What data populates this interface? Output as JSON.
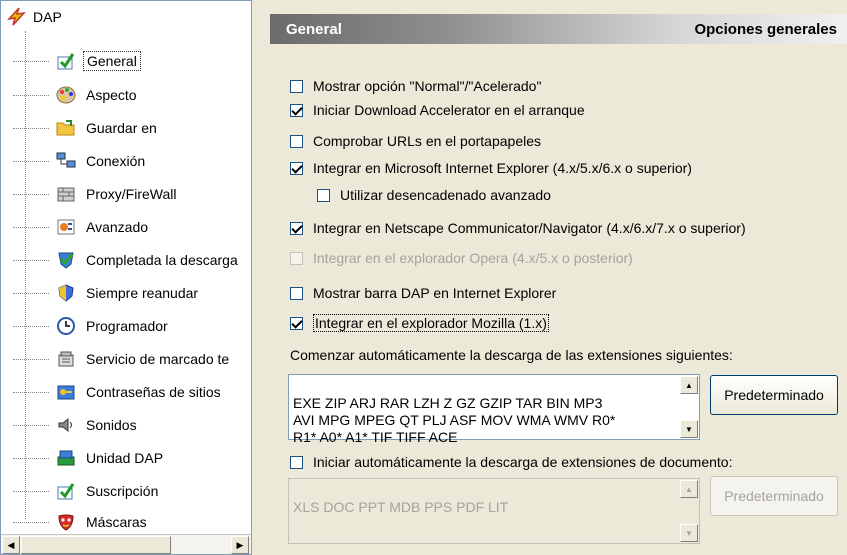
{
  "tree": {
    "root_label": "DAP",
    "items": [
      {
        "label": "General",
        "icon": "check-icon",
        "selected": true
      },
      {
        "label": "Aspecto",
        "icon": "palette-icon"
      },
      {
        "label": "Guardar en",
        "icon": "folder-icon"
      },
      {
        "label": "Conexión",
        "icon": "network-icon"
      },
      {
        "label": "Proxy/FireWall",
        "icon": "firewall-icon"
      },
      {
        "label": "Avanzado",
        "icon": "advanced-icon"
      },
      {
        "label": "Completada la descarga",
        "icon": "checkmark-shield-icon"
      },
      {
        "label": "Siempre reanudar",
        "icon": "shield-icon"
      },
      {
        "label": "Programador",
        "icon": "clock-icon"
      },
      {
        "label": "Servicio de marcado te",
        "icon": "phone-icon"
      },
      {
        "label": "Contraseñas de sitios",
        "icon": "key-icon"
      },
      {
        "label": "Sonidos",
        "icon": "speaker-icon"
      },
      {
        "label": "Unidad DAP",
        "icon": "drive-icon"
      },
      {
        "label": "Suscripción",
        "icon": "check-icon"
      },
      {
        "label": "Máscaras",
        "icon": "mask-icon"
      }
    ]
  },
  "header": {
    "title_left": "General",
    "title_right": "Opciones generales"
  },
  "options": [
    {
      "label": "Mostrar opción \"Normal\"/\"Acelerado\"",
      "checked": false
    },
    {
      "label": "Iniciar Download Accelerator en el arranque",
      "checked": true
    },
    {
      "label": "Comprobar URLs en el portapapeles",
      "checked": false
    },
    {
      "label": "Integrar en Microsoft Internet Explorer (4.x/5.x/6.x o superior)",
      "checked": true
    },
    {
      "label": "Utilizar desencadenado avanzado",
      "checked": false
    },
    {
      "label": "Integrar en Netscape Communicator/Navigator (4.x/6.x/7.x o superior)",
      "checked": true
    },
    {
      "label": "Integrar en el explorador Opera (4.x/5.x o posterior)",
      "checked": false,
      "disabled": true
    },
    {
      "label": "Mostrar barra DAP en Internet Explorer",
      "checked": false
    },
    {
      "label": "Integrar en el explorador Mozilla (1.x)",
      "checked": true,
      "focused": true
    }
  ],
  "extensions": {
    "label": "Comenzar automáticamente la descarga de las extensiones siguientes:",
    "value": "EXE ZIP ARJ RAR LZH Z GZ GZIP TAR BIN MP3\nAVI MPG MPEG QT PLJ ASF MOV WMA WMV R0*\nR1* A0* A1* TIF TIFF ACE",
    "default_button": "Predeterminado"
  },
  "doc_extensions": {
    "checkbox_label": "Iniciar automáticamente la descarga de extensiones de documento:",
    "checked": false,
    "value": "XLS DOC PPT MDB PPS PDF LIT",
    "default_button": "Predeterminado"
  }
}
